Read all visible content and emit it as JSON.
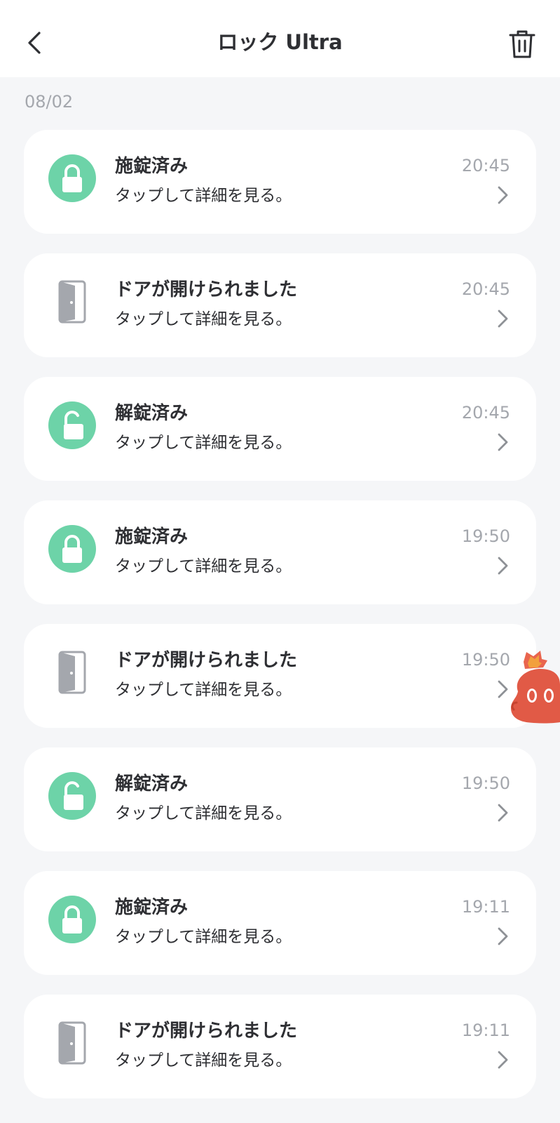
{
  "header": {
    "title": "ロック Ultra",
    "back_icon": "chevron-left-icon",
    "trash_icon": "trash-icon"
  },
  "date_group": "08/02",
  "colors": {
    "accent_green": "#6DD3A8",
    "door_gray": "#A4A7AD",
    "background": "#F5F6F8",
    "mascot_red": "#E15A46"
  },
  "events": [
    {
      "type": "locked",
      "icon": "lock-closed-icon",
      "title": "施錠済み",
      "subtitle": "タップして詳細を見る。",
      "time": "20:45"
    },
    {
      "type": "door",
      "icon": "door-open-icon",
      "title": "ドアが開けられました",
      "subtitle": "タップして詳細を見る。",
      "time": "20:45"
    },
    {
      "type": "unlocked",
      "icon": "lock-open-icon",
      "title": "解錠済み",
      "subtitle": "タップして詳細を見る。",
      "time": "20:45"
    },
    {
      "type": "locked",
      "icon": "lock-closed-icon",
      "title": "施錠済み",
      "subtitle": "タップして詳細を見る。",
      "time": "19:50"
    },
    {
      "type": "door",
      "icon": "door-open-icon",
      "title": "ドアが開けられました",
      "subtitle": "タップして詳細を見る。",
      "time": "19:50"
    },
    {
      "type": "unlocked",
      "icon": "lock-open-icon",
      "title": "解錠済み",
      "subtitle": "タップして詳細を見る。",
      "time": "19:50"
    },
    {
      "type": "locked",
      "icon": "lock-closed-icon",
      "title": "施錠済み",
      "subtitle": "タップして詳細を見る。",
      "time": "19:11"
    },
    {
      "type": "door",
      "icon": "door-open-icon",
      "title": "ドアが開けられました",
      "subtitle": "タップして詳細を見る。",
      "time": "19:11"
    }
  ]
}
